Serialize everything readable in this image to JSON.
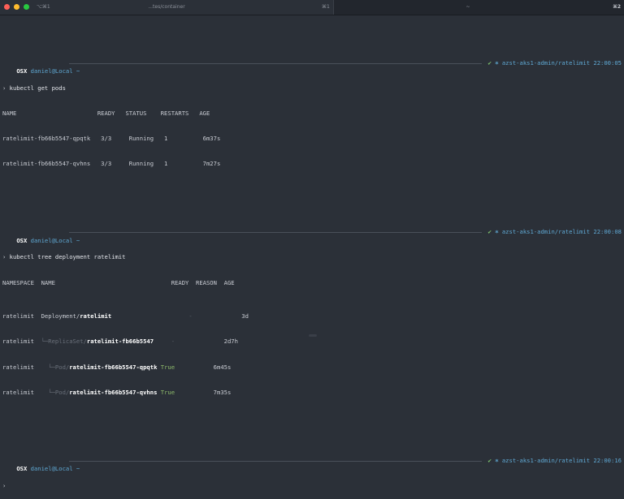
{
  "window": {
    "tab1_shortcut": "⌥⌘1",
    "tab1_title": "...tes/container",
    "tab1_number": "⌘1",
    "tab2_title": "~",
    "tab2_number": "⌘2"
  },
  "prompt": {
    "host": "OSX",
    "user": "daniel@Local",
    "dir": "~",
    "symbol": "›",
    "check": "✔",
    "context": "⎈ azst-aks1-admin/ratelimit"
  },
  "blocks": [
    {
      "time": "22:00:05",
      "command": "kubectl get pods",
      "header": "NAME                       READY   STATUS    RESTARTS   AGE",
      "rows": [
        "ratelimit-fb66b5547-qpqtk   3/3     Running   1          6m37s",
        "ratelimit-fb66b5547-qvhns   3/3     Running   1          7m27s"
      ]
    },
    {
      "time": "22:00:08",
      "command": "kubectl tree deployment ratelimit",
      "header": "NAMESPACE  NAME                                 READY  REASON  AGE",
      "rows": [
        {
          "ns": "ratelimit",
          "pre": "  Deployment/",
          "bold": "ratelimit",
          "pad": "                    ",
          "ready": "-",
          "age": "3d"
        },
        {
          "ns": "ratelimit",
          "pre": "  └─ReplicaSet/",
          "bold": "ratelimit-fb66b5547",
          "pad": "   ",
          "ready": "-",
          "age": "2d7h"
        },
        {
          "ns": "ratelimit",
          "pre": "    └─Pod/",
          "bold": "ratelimit-fb66b5547-qpqtk",
          "pad": " ",
          "ready": "True",
          "age": "6m45s"
        },
        {
          "ns": "ratelimit",
          "pre": "    └─Pod/",
          "bold": "ratelimit-fb66b5547-qvhns",
          "pad": " ",
          "ready": "True",
          "age": "7m35s"
        }
      ]
    },
    {
      "time": "22:00:16"
    }
  ]
}
